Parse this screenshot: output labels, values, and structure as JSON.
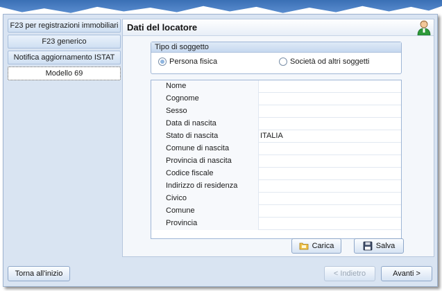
{
  "sidebar": {
    "items": [
      {
        "label": "F23 per registrazioni immobiliari"
      },
      {
        "label": "F23 generico"
      },
      {
        "label": "Notifica aggiornamento ISTAT"
      },
      {
        "label": "Modello 69"
      }
    ]
  },
  "panel": {
    "title": "Dati del locatore",
    "subject_group": {
      "title": "Tipo di soggetto",
      "options": [
        {
          "label": "Persona fisica",
          "selected": true
        },
        {
          "label": "Società od altri soggetti",
          "selected": false
        }
      ]
    },
    "fields": [
      {
        "label": "Nome",
        "value": ""
      },
      {
        "label": "Cognome",
        "value": ""
      },
      {
        "label": "Sesso",
        "value": ""
      },
      {
        "label": "Data di nascita",
        "value": ""
      },
      {
        "label": "Stato di nascita",
        "value": "ITALIA"
      },
      {
        "label": "Comune di nascita",
        "value": ""
      },
      {
        "label": "Provincia di nascita",
        "value": ""
      },
      {
        "label": "Codice fiscale",
        "value": ""
      },
      {
        "label": "Indirizzo di residenza",
        "value": ""
      },
      {
        "label": "Civico",
        "value": ""
      },
      {
        "label": "Comune",
        "value": ""
      },
      {
        "label": "Provincia",
        "value": ""
      }
    ],
    "buttons": {
      "load_label": "Carica",
      "save_label": "Salva"
    }
  },
  "footer": {
    "home_label": "Torna all'inizio",
    "back_label": "< Indietro",
    "next_label": "Avanti >"
  },
  "icons": {
    "user": "user-icon",
    "load": "folder-icon",
    "save": "floppy-disk-icon"
  },
  "colors": {
    "window_bg": "#d9e4f2",
    "accent": "#3a6fb5"
  }
}
